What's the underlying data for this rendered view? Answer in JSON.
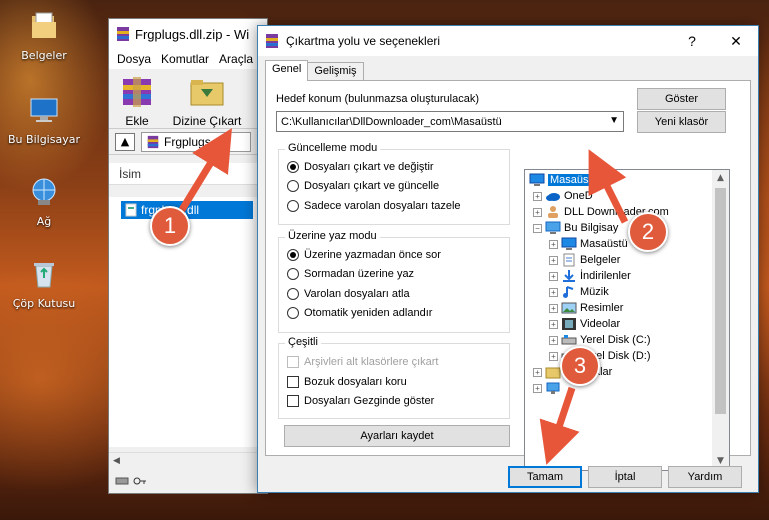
{
  "desktop": {
    "icons": [
      {
        "label": "Belgeler",
        "icon": "folder-icon"
      },
      {
        "label": "Bu Bilgisayar",
        "icon": "computer-icon"
      },
      {
        "label": "Ağ",
        "icon": "network-icon"
      },
      {
        "label": "Çöp Kutusu",
        "icon": "recycle-bin-icon"
      }
    ]
  },
  "winrar": {
    "title": "Frgplugs.dll.zip - Wi",
    "menu": [
      "Dosya",
      "Komutlar",
      "Araçla"
    ],
    "toolbar": {
      "add_label": "Ekle",
      "extract_label": "Dizine Çıkart"
    },
    "address": "Frgplugs.dl",
    "list_header": "İsim",
    "file_name": "frgplugs.dll"
  },
  "dialog": {
    "title": "Çıkartma yolu ve seçenekleri",
    "tabs": [
      "Genel",
      "Gelişmiş"
    ],
    "destination_label": "Hedef konum (bulunmazsa oluşturulacak)",
    "destination_value": "C:\\Kullanıcılar\\DllDownloader_com\\Masaüstü",
    "show_button": "Göster",
    "new_folder_button": "Yeni klasör",
    "update_mode": {
      "title": "Güncelleme modu",
      "options": [
        "Dosyaları çıkart ve değiştir",
        "Dosyaları çıkart ve güncelle",
        "Sadece varolan dosyaları tazele"
      ],
      "selected": 0
    },
    "overwrite_mode": {
      "title": "Üzerine yaz modu",
      "options": [
        "Üzerine yazmadan önce sor",
        "Sormadan üzerine yaz",
        "Varolan dosyaları atla",
        "Otomatik yeniden adlandır"
      ],
      "selected": 0
    },
    "misc": {
      "title": "Çeşitli",
      "options": [
        "Arşivleri alt klasörlere çıkart",
        "Bozuk dosyaları koru",
        "Dosyaları Gezginde göster"
      ]
    },
    "save_settings_button": "Ayarları kaydet",
    "tree": [
      {
        "label": "Masaüstü",
        "icon": "desktop-icon",
        "selected": true
      },
      {
        "label": "OneD",
        "icon": "onedrive-icon"
      },
      {
        "label": "DLL Downloader.com",
        "icon": "user-icon"
      },
      {
        "label": "Bu Bilgisay",
        "icon": "computer-icon"
      },
      {
        "label": "Masaüstü",
        "icon": "desktop-icon"
      },
      {
        "label": "Belgeler",
        "icon": "documents-icon"
      },
      {
        "label": "İndirilenler",
        "icon": "download-icon"
      },
      {
        "label": "Müzik",
        "icon": "music-icon"
      },
      {
        "label": "Resimler",
        "icon": "pictures-icon"
      },
      {
        "label": "Videolar",
        "icon": "videos-icon"
      },
      {
        "label": "Yerel Disk (C:)",
        "icon": "drive-icon"
      },
      {
        "label": "Yerel Disk (D:)",
        "icon": "drive-icon"
      },
      {
        "label": "Kitaplıklar",
        "icon": "libraries-icon"
      },
      {
        "label": "",
        "icon": "network-icon"
      }
    ],
    "ok_button": "Tamam",
    "cancel_button": "İptal",
    "help_button": "Yardım"
  },
  "annotations": [
    "1",
    "2",
    "3"
  ],
  "colors": {
    "selection": "#0078d7",
    "badge": "#e05b3c",
    "arrow": "#e8563a"
  }
}
